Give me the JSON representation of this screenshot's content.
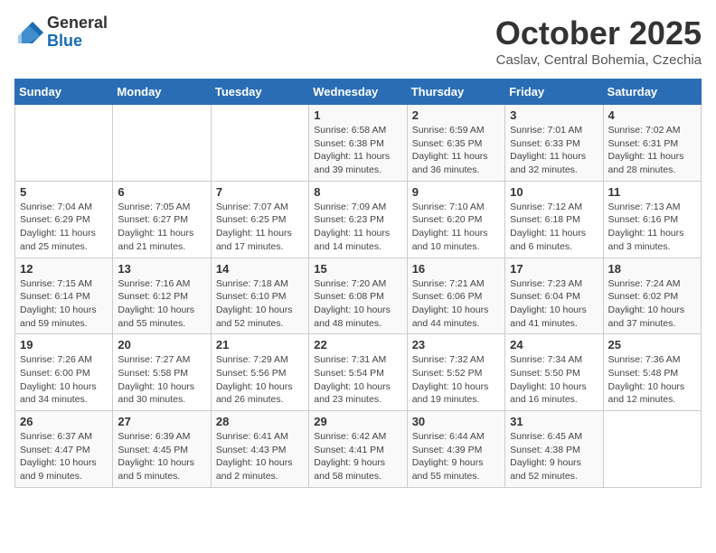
{
  "header": {
    "logo_general": "General",
    "logo_blue": "Blue",
    "month": "October 2025",
    "location": "Caslav, Central Bohemia, Czechia"
  },
  "days_of_week": [
    "Sunday",
    "Monday",
    "Tuesday",
    "Wednesday",
    "Thursday",
    "Friday",
    "Saturday"
  ],
  "weeks": [
    [
      {
        "day": "",
        "info": ""
      },
      {
        "day": "",
        "info": ""
      },
      {
        "day": "",
        "info": ""
      },
      {
        "day": "1",
        "info": "Sunrise: 6:58 AM\nSunset: 6:38 PM\nDaylight: 11 hours and 39 minutes."
      },
      {
        "day": "2",
        "info": "Sunrise: 6:59 AM\nSunset: 6:35 PM\nDaylight: 11 hours and 36 minutes."
      },
      {
        "day": "3",
        "info": "Sunrise: 7:01 AM\nSunset: 6:33 PM\nDaylight: 11 hours and 32 minutes."
      },
      {
        "day": "4",
        "info": "Sunrise: 7:02 AM\nSunset: 6:31 PM\nDaylight: 11 hours and 28 minutes."
      }
    ],
    [
      {
        "day": "5",
        "info": "Sunrise: 7:04 AM\nSunset: 6:29 PM\nDaylight: 11 hours and 25 minutes."
      },
      {
        "day": "6",
        "info": "Sunrise: 7:05 AM\nSunset: 6:27 PM\nDaylight: 11 hours and 21 minutes."
      },
      {
        "day": "7",
        "info": "Sunrise: 7:07 AM\nSunset: 6:25 PM\nDaylight: 11 hours and 17 minutes."
      },
      {
        "day": "8",
        "info": "Sunrise: 7:09 AM\nSunset: 6:23 PM\nDaylight: 11 hours and 14 minutes."
      },
      {
        "day": "9",
        "info": "Sunrise: 7:10 AM\nSunset: 6:20 PM\nDaylight: 11 hours and 10 minutes."
      },
      {
        "day": "10",
        "info": "Sunrise: 7:12 AM\nSunset: 6:18 PM\nDaylight: 11 hours and 6 minutes."
      },
      {
        "day": "11",
        "info": "Sunrise: 7:13 AM\nSunset: 6:16 PM\nDaylight: 11 hours and 3 minutes."
      }
    ],
    [
      {
        "day": "12",
        "info": "Sunrise: 7:15 AM\nSunset: 6:14 PM\nDaylight: 10 hours and 59 minutes."
      },
      {
        "day": "13",
        "info": "Sunrise: 7:16 AM\nSunset: 6:12 PM\nDaylight: 10 hours and 55 minutes."
      },
      {
        "day": "14",
        "info": "Sunrise: 7:18 AM\nSunset: 6:10 PM\nDaylight: 10 hours and 52 minutes."
      },
      {
        "day": "15",
        "info": "Sunrise: 7:20 AM\nSunset: 6:08 PM\nDaylight: 10 hours and 48 minutes."
      },
      {
        "day": "16",
        "info": "Sunrise: 7:21 AM\nSunset: 6:06 PM\nDaylight: 10 hours and 44 minutes."
      },
      {
        "day": "17",
        "info": "Sunrise: 7:23 AM\nSunset: 6:04 PM\nDaylight: 10 hours and 41 minutes."
      },
      {
        "day": "18",
        "info": "Sunrise: 7:24 AM\nSunset: 6:02 PM\nDaylight: 10 hours and 37 minutes."
      }
    ],
    [
      {
        "day": "19",
        "info": "Sunrise: 7:26 AM\nSunset: 6:00 PM\nDaylight: 10 hours and 34 minutes."
      },
      {
        "day": "20",
        "info": "Sunrise: 7:27 AM\nSunset: 5:58 PM\nDaylight: 10 hours and 30 minutes."
      },
      {
        "day": "21",
        "info": "Sunrise: 7:29 AM\nSunset: 5:56 PM\nDaylight: 10 hours and 26 minutes."
      },
      {
        "day": "22",
        "info": "Sunrise: 7:31 AM\nSunset: 5:54 PM\nDaylight: 10 hours and 23 minutes."
      },
      {
        "day": "23",
        "info": "Sunrise: 7:32 AM\nSunset: 5:52 PM\nDaylight: 10 hours and 19 minutes."
      },
      {
        "day": "24",
        "info": "Sunrise: 7:34 AM\nSunset: 5:50 PM\nDaylight: 10 hours and 16 minutes."
      },
      {
        "day": "25",
        "info": "Sunrise: 7:36 AM\nSunset: 5:48 PM\nDaylight: 10 hours and 12 minutes."
      }
    ],
    [
      {
        "day": "26",
        "info": "Sunrise: 6:37 AM\nSunset: 4:47 PM\nDaylight: 10 hours and 9 minutes."
      },
      {
        "day": "27",
        "info": "Sunrise: 6:39 AM\nSunset: 4:45 PM\nDaylight: 10 hours and 5 minutes."
      },
      {
        "day": "28",
        "info": "Sunrise: 6:41 AM\nSunset: 4:43 PM\nDaylight: 10 hours and 2 minutes."
      },
      {
        "day": "29",
        "info": "Sunrise: 6:42 AM\nSunset: 4:41 PM\nDaylight: 9 hours and 58 minutes."
      },
      {
        "day": "30",
        "info": "Sunrise: 6:44 AM\nSunset: 4:39 PM\nDaylight: 9 hours and 55 minutes."
      },
      {
        "day": "31",
        "info": "Sunrise: 6:45 AM\nSunset: 4:38 PM\nDaylight: 9 hours and 52 minutes."
      },
      {
        "day": "",
        "info": ""
      }
    ]
  ]
}
